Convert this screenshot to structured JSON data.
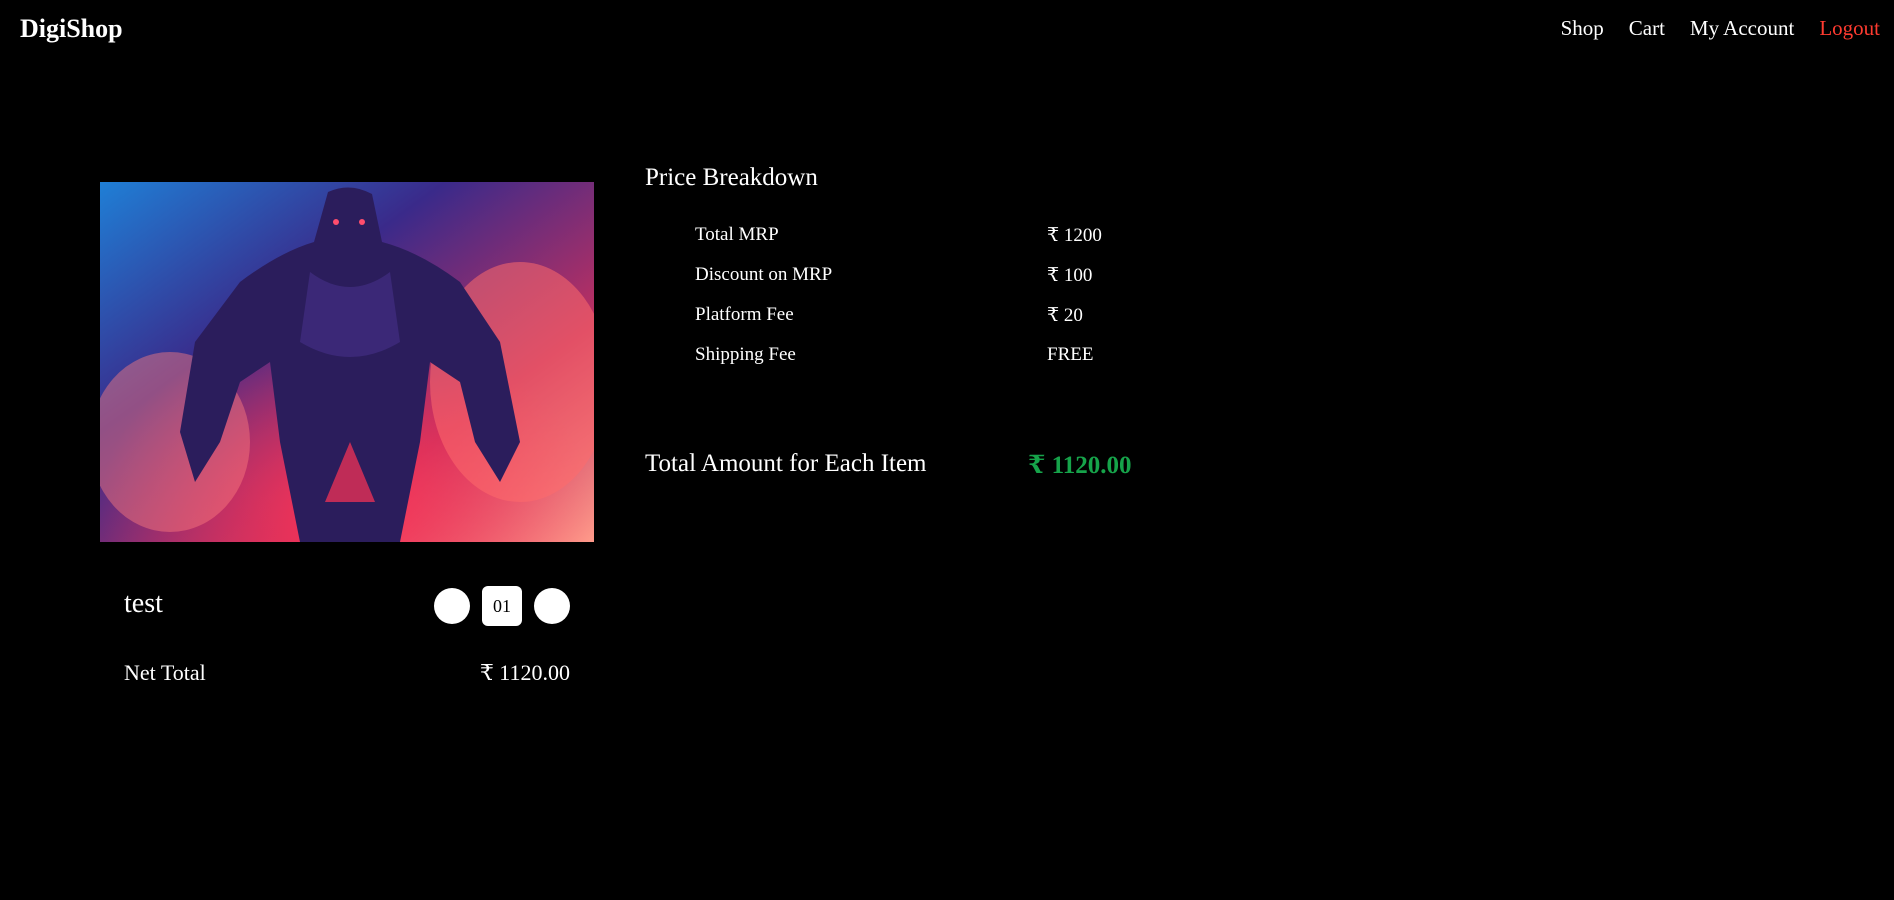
{
  "header": {
    "brand": "DigiShop",
    "nav": {
      "shop": "Shop",
      "cart": "Cart",
      "account": "My Account",
      "logout": "Logout"
    },
    "logout_color": "#ff3b30"
  },
  "product": {
    "name": "test",
    "quantity": "01",
    "net_total_label": "Net Total",
    "net_total_value": "₹ 1120.00"
  },
  "price_breakdown": {
    "title": "Price Breakdown",
    "lines": [
      {
        "label": "Total MRP",
        "value": "₹ 1200"
      },
      {
        "label": "Discount on MRP",
        "value": "₹ 100"
      },
      {
        "label": "Platform Fee",
        "value": "₹ 20"
      },
      {
        "label": "Shipping Fee",
        "value": "FREE"
      }
    ],
    "total_label": "Total Amount for Each Item",
    "total_value": "₹ 1120.00",
    "total_color": "#16a34a"
  }
}
